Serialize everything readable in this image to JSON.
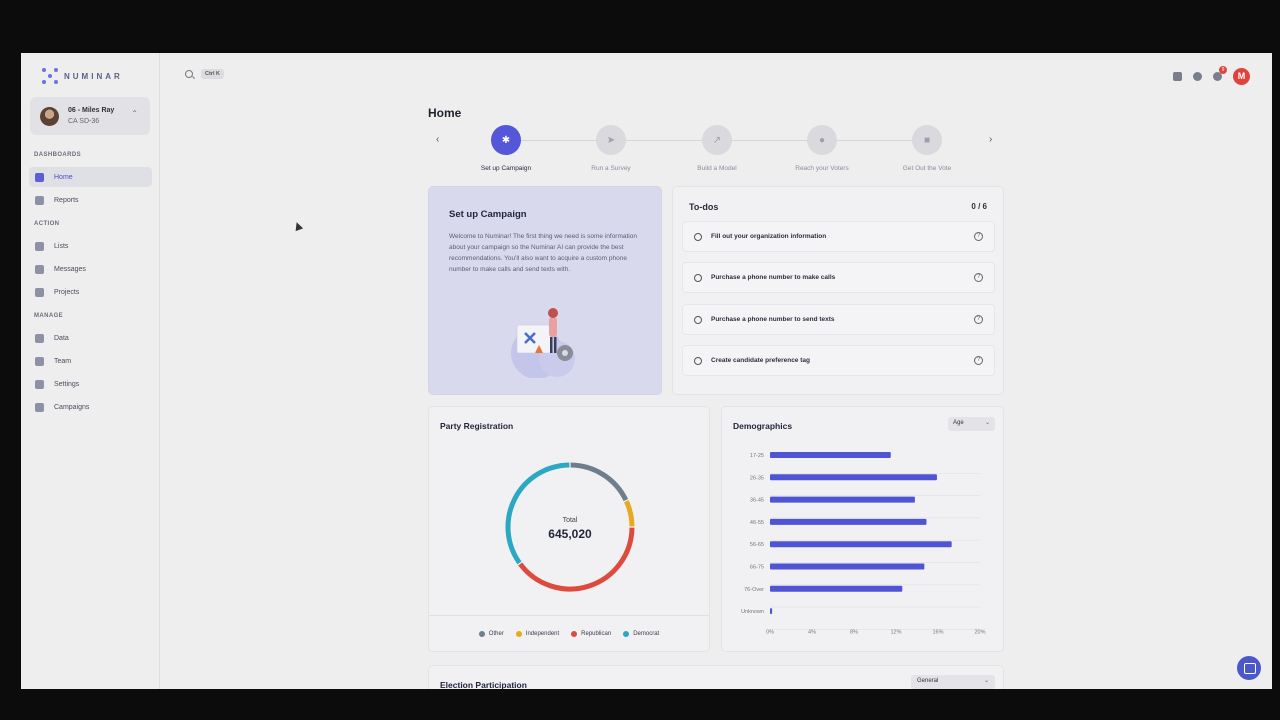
{
  "app": {
    "brand": "NUMINAR"
  },
  "account": {
    "name": "06 - Miles Ray",
    "district": "CA SD-36"
  },
  "sidebar": {
    "sections": [
      {
        "label": "DASHBOARDS",
        "items": [
          {
            "label": "Home",
            "icon": "home-icon",
            "active": true
          },
          {
            "label": "Reports",
            "icon": "chart-icon"
          }
        ]
      },
      {
        "label": "ACTION",
        "items": [
          {
            "label": "Lists",
            "icon": "list-icon"
          },
          {
            "label": "Messages",
            "icon": "message-icon"
          },
          {
            "label": "Projects",
            "icon": "project-icon"
          }
        ]
      },
      {
        "label": "MANAGE",
        "items": [
          {
            "label": "Data",
            "icon": "data-icon"
          },
          {
            "label": "Team",
            "icon": "team-icon"
          },
          {
            "label": "Settings",
            "icon": "gear-icon"
          },
          {
            "label": "Campaigns",
            "icon": "building-icon"
          }
        ]
      }
    ]
  },
  "topbar": {
    "shortcut": "Ctrl K",
    "notification_count": "9",
    "user_initial": "M"
  },
  "main": {
    "title": "Home"
  },
  "stepper": {
    "steps": [
      {
        "label": "Set up Campaign",
        "icon": "gear-icon",
        "active": true
      },
      {
        "label": "Run a Survey",
        "icon": "send-icon"
      },
      {
        "label": "Build a Model",
        "icon": "trend-icon"
      },
      {
        "label": "Reach your Voters",
        "icon": "people-icon"
      },
      {
        "label": "Get Out the Vote",
        "icon": "ballot-icon"
      }
    ]
  },
  "setup": {
    "title": "Set up Campaign",
    "description": "Welcome to Numinar! The first thing we need is some information about your campaign so the Numinar AI can provide the best recommendations. You'll also want to acquire a custom phone number to make calls and send texts with."
  },
  "todos": {
    "title": "To-dos",
    "count": "0 / 6",
    "items": [
      "Fill out your organization information",
      "Purchase a phone number to make calls",
      "Purchase a phone number to send texts",
      "Create candidate preference tag"
    ]
  },
  "party": {
    "title": "Party Registration",
    "total_label": "Total",
    "total_value": "645,020",
    "legend": [
      {
        "name": "Other",
        "color": "#6e7e8c"
      },
      {
        "name": "Independent",
        "color": "#e8a820"
      },
      {
        "name": "Republican",
        "color": "#dc4b3e"
      },
      {
        "name": "Democrat",
        "color": "#2aa8c4"
      }
    ]
  },
  "demographics": {
    "title": "Demographics",
    "select": "Age"
  },
  "election": {
    "title": "Election Participation",
    "select": "General"
  },
  "chart_data": [
    {
      "type": "pie",
      "title": "Party Registration",
      "categories": [
        "Other",
        "Independent",
        "Republican",
        "Democrat"
      ],
      "values": [
        18,
        7,
        40,
        35
      ],
      "colors": [
        "#6e7e8c",
        "#e8a820",
        "#dc4b3e",
        "#2aa8c4"
      ]
    },
    {
      "type": "bar",
      "title": "Demographics",
      "categories": [
        "17-25",
        "26-35",
        "36-45",
        "46-55",
        "56-65",
        "66-75",
        "76-Over",
        "Unknown"
      ],
      "values": [
        11.5,
        15.9,
        13.8,
        14.9,
        17.3,
        14.7,
        12.6,
        0.2
      ],
      "xlim": [
        0,
        20
      ],
      "ticks": [
        "0%",
        "4%",
        "8%",
        "12%",
        "16%",
        "20%"
      ],
      "color": "#4f54d4",
      "grid": true
    }
  ]
}
